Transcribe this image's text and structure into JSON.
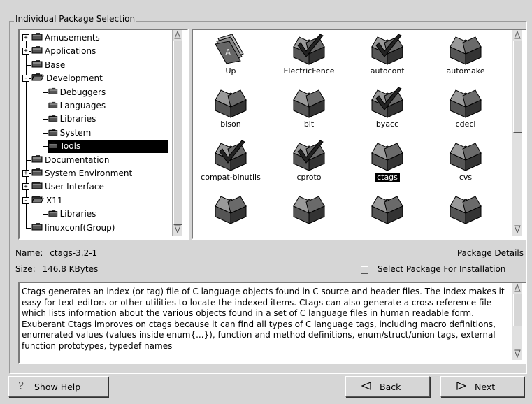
{
  "group": {
    "title": "Individual Package Selection"
  },
  "tree": {
    "items": [
      {
        "label": "Amusements",
        "expander": "+"
      },
      {
        "label": "Applications",
        "expander": "+"
      },
      {
        "label": "Base",
        "expander": ""
      },
      {
        "label": "Development",
        "expander": "-"
      },
      {
        "label": "Debuggers",
        "expander": ""
      },
      {
        "label": "Languages",
        "expander": ""
      },
      {
        "label": "Libraries",
        "expander": ""
      },
      {
        "label": "System",
        "expander": ""
      },
      {
        "label": "Tools",
        "expander": "",
        "selected": true
      },
      {
        "label": "Documentation",
        "expander": ""
      },
      {
        "label": "System Environment",
        "expander": "+"
      },
      {
        "label": "User Interface",
        "expander": "+"
      },
      {
        "label": "X11",
        "expander": "-"
      },
      {
        "label": "Libraries",
        "expander": ""
      },
      {
        "label": "linuxconf(Group)",
        "expander": ""
      }
    ]
  },
  "packages": [
    {
      "label": "Up",
      "icon": "up-folder-icon"
    },
    {
      "label": "ElectricFence",
      "icon": "package-checked-icon"
    },
    {
      "label": "autoconf",
      "icon": "package-checked-icon"
    },
    {
      "label": "automake",
      "icon": "package-icon"
    },
    {
      "label": "bison",
      "icon": "package-icon"
    },
    {
      "label": "blt",
      "icon": "package-icon"
    },
    {
      "label": "byacc",
      "icon": "package-checked-icon"
    },
    {
      "label": "cdecl",
      "icon": "package-icon"
    },
    {
      "label": "compat-binutils",
      "icon": "package-checked-icon"
    },
    {
      "label": "cproto",
      "icon": "package-checked-icon"
    },
    {
      "label": "ctags",
      "icon": "package-icon",
      "selected": true
    },
    {
      "label": "cvs",
      "icon": "package-icon"
    }
  ],
  "info": {
    "name_label": "Name:",
    "name_value": "ctags-3.2-1",
    "size_label": "Size:",
    "size_value": "146.8 KBytes",
    "details_label": "Package Details",
    "select_label": "Select Package For Installation",
    "select_checked": false
  },
  "description": "Ctags generates an index (or tag) file of C language objects found in C source and header files.  The index makes it easy for text editors or other utilities to locate the indexed items.  Ctags can also generate a cross reference file which lists information about the various objects found in a set of C language files in human readable form.  Exuberant Ctags improves on ctags because it can find all types of C language tags, including macro definitions, enumerated values (values inside enum{...}), function and method definitions, enum/struct/union tags, external function prototypes, typedef names",
  "buttons": {
    "help": "Show Help",
    "back": "Back",
    "next": "Next"
  },
  "colors": {
    "background": "#d6d6d6",
    "selection": "#000000",
    "field": "#ffffff"
  }
}
